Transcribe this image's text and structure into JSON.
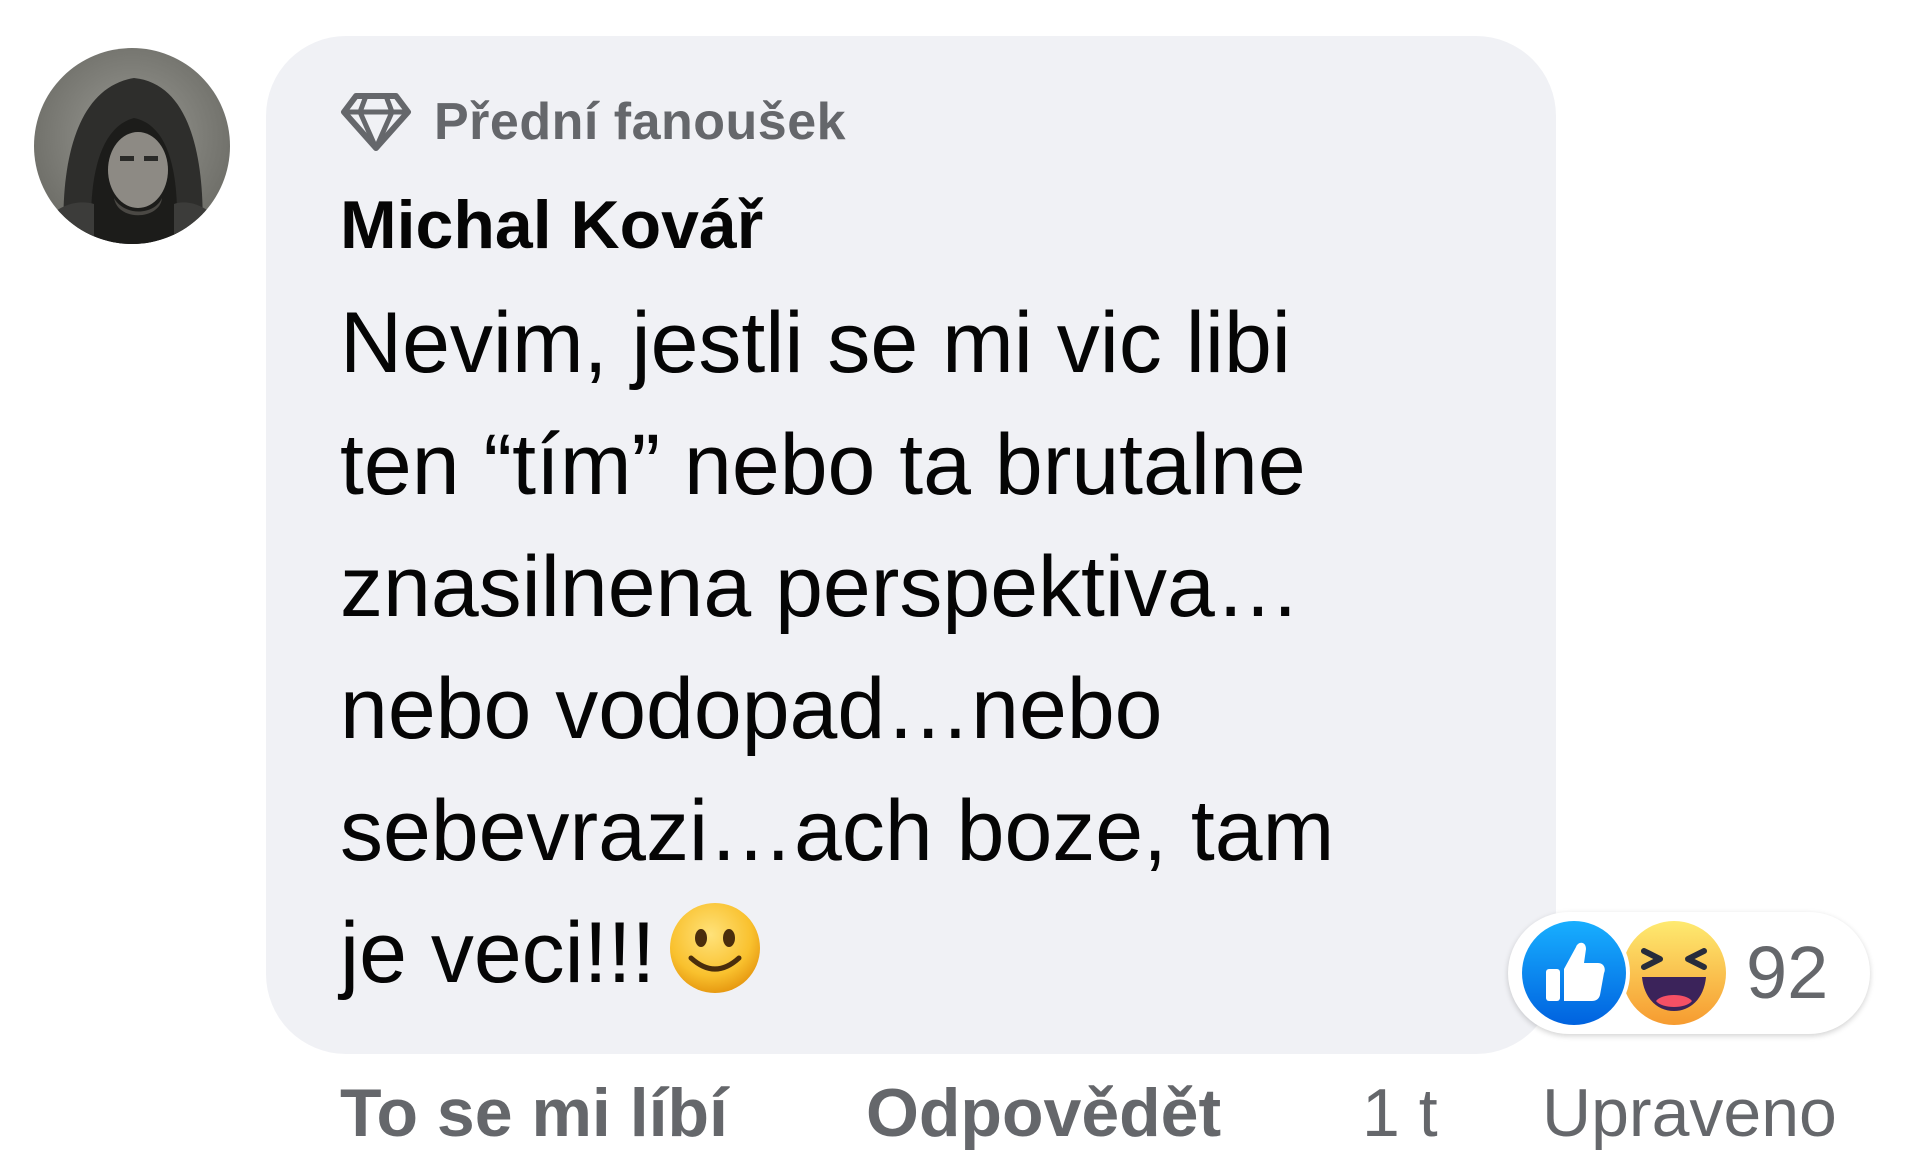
{
  "comment": {
    "badge_label": "Přední fanoušek",
    "badge_icon": "diamond-icon",
    "author": "Michal Kovář",
    "text_lines": [
      "Nevim, jestli se mi vic libi",
      "ten “tím” nebo ta brutalne",
      "znasilnena perspektiva…",
      "nebo vodopad…nebo",
      "sebevrazi…ach boze, tam",
      "je veci!!!"
    ],
    "emoji": "slightly-smiling-face"
  },
  "reactions": {
    "icons": [
      "like-reaction-icon",
      "haha-reaction-icon"
    ],
    "count": "92"
  },
  "actions": {
    "like_label": "To se mi líbí",
    "reply_label": "Odpovědět",
    "time": "1 t",
    "edited_label": "Upraveno"
  },
  "colors": {
    "bubble": "#f0f1f5",
    "secondary_text": "#65676b",
    "like_blue": "#1877f2",
    "haha_yellow": "#f7b125"
  }
}
